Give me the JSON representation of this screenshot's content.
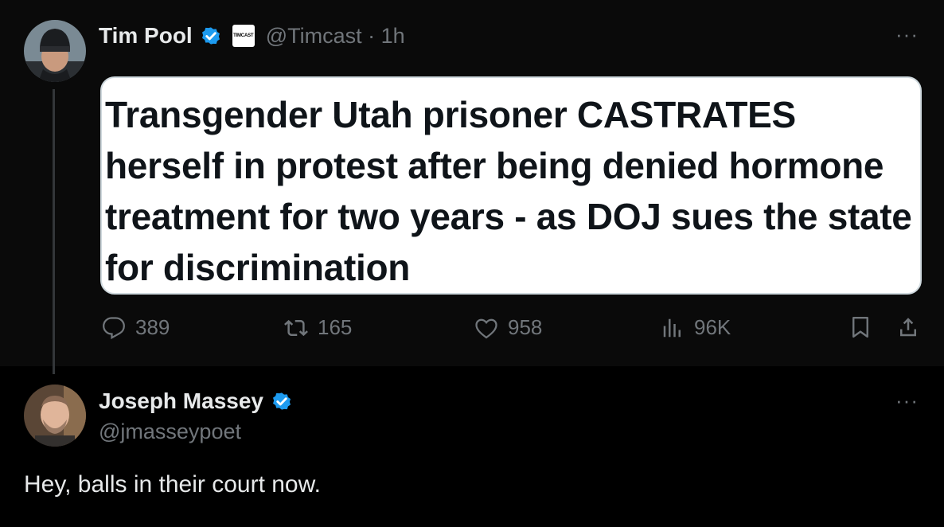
{
  "quoted_tweet": {
    "author_name": "Tim Pool",
    "affiliate_badge": "TIMCAST",
    "handle_time": "@Timcast · 1h",
    "more": "···",
    "headline": "Transgender Utah prisoner CASTRATES herself in protest after being denied hormone treatment for two years - as DOJ sues the state for discrimination",
    "metrics": {
      "replies": "389",
      "reposts": "165",
      "likes": "958",
      "views": "96K"
    }
  },
  "reply_tweet": {
    "author_name": "Joseph Massey",
    "handle": "@jmasseypoet",
    "more": "···",
    "text": "Hey, balls in their court now."
  },
  "colors": {
    "background": "#000000",
    "quoted_background": "#0a0a0a",
    "verified_blue": "#1d9bf0",
    "muted": "#71767b",
    "text": "#e7e9ea"
  }
}
